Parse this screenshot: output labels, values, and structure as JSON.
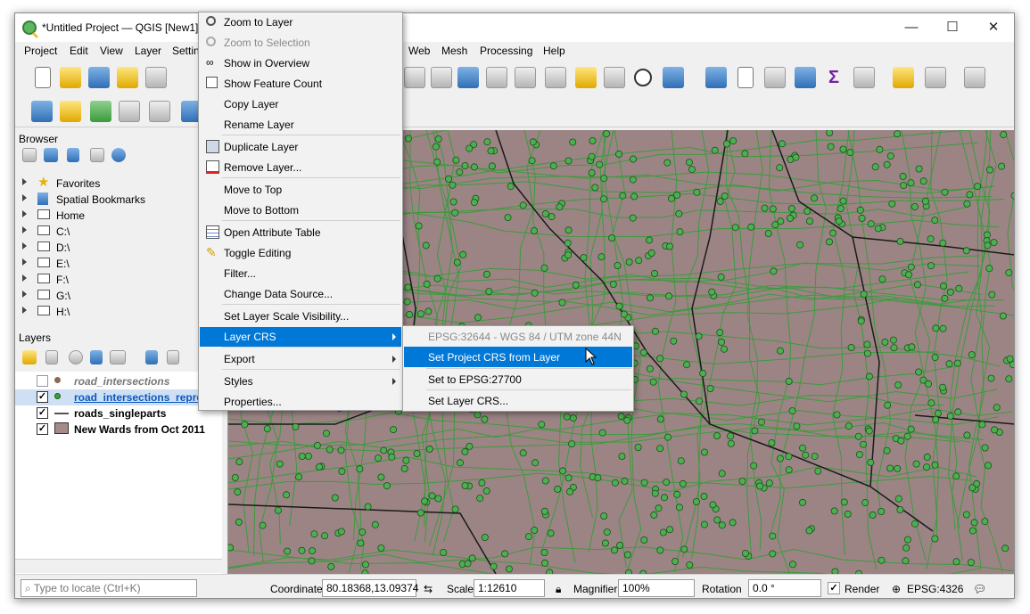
{
  "window": {
    "title": "*Untitled Project — QGIS [New1]",
    "controls": {
      "minimize": "—",
      "maximize": "☐",
      "close": "✕"
    }
  },
  "menubar": {
    "items": [
      "Project",
      "Edit",
      "View",
      "Layer",
      "Settin",
      "Web",
      "Mesh",
      "Processing",
      "Help"
    ]
  },
  "browser": {
    "title": "Browser",
    "items": [
      "Favorites",
      "Spatial Bookmarks",
      "Home",
      "C:\\",
      "D:\\",
      "E:\\",
      "F:\\",
      "G:\\",
      "H:\\"
    ]
  },
  "layers": {
    "title": "Layers",
    "items": [
      {
        "name": "road_intersections",
        "checked": false,
        "style": "italic-grey"
      },
      {
        "name": "road_intersections_repro",
        "checked": true,
        "style": "selected"
      },
      {
        "name": "roads_singleparts",
        "checked": true,
        "style": "bold"
      },
      {
        "name": "New Wards from Oct 2011",
        "checked": true,
        "style": "bold"
      }
    ],
    "check_mark": "✓"
  },
  "context_menu": {
    "items": [
      {
        "label": "Zoom to Layer",
        "icon": "zoom-icon",
        "disabled": false
      },
      {
        "label": "Zoom to Selection",
        "icon": "zoom-selection-icon",
        "disabled": true
      },
      {
        "label": "Show in Overview",
        "icon": "overview-icon",
        "disabled": false
      },
      {
        "label": "Show Feature Count",
        "icon": "checkbox-icon",
        "disabled": false
      },
      {
        "label": "Copy Layer",
        "icon": "",
        "disabled": false
      },
      {
        "label": "Rename Layer",
        "icon": "",
        "disabled": false
      },
      {
        "label": "Duplicate Layer",
        "icon": "duplicate-icon",
        "disabled": false
      },
      {
        "label": "Remove Layer...",
        "icon": "remove-layer-icon",
        "disabled": false
      },
      {
        "label": "Move to Top",
        "icon": "",
        "disabled": false
      },
      {
        "label": "Move to Bottom",
        "icon": "",
        "disabled": false
      },
      {
        "label": "Open Attribute Table",
        "icon": "table-icon",
        "disabled": false
      },
      {
        "label": "Toggle Editing",
        "icon": "pencil-icon",
        "disabled": false
      },
      {
        "label": "Filter...",
        "icon": "",
        "disabled": false
      },
      {
        "label": "Change Data Source...",
        "icon": "",
        "disabled": false
      },
      {
        "label": "Set Layer Scale Visibility...",
        "icon": "",
        "disabled": false
      },
      {
        "label": "Layer CRS",
        "icon": "",
        "disabled": false,
        "submenu": true
      },
      {
        "label": "Export",
        "icon": "",
        "disabled": false,
        "submenu": true
      },
      {
        "label": "Styles",
        "icon": "",
        "disabled": false,
        "submenu": true
      },
      {
        "label": "Properties...",
        "icon": "",
        "disabled": false
      }
    ]
  },
  "crs_submenu": {
    "items": [
      {
        "label": "EPSG:32644 - WGS 84 / UTM zone 44N",
        "disabled": true
      },
      {
        "label": "Set Project CRS from Layer",
        "disabled": false
      },
      {
        "label": "Set to EPSG:27700",
        "disabled": false
      },
      {
        "label": "Set Layer CRS...",
        "disabled": false
      }
    ]
  },
  "statusbar": {
    "locator_placeholder": "Type to locate (Ctrl+K)",
    "coordinate_label": "Coordinate",
    "coordinate_value": "80.18368,13.09374",
    "scale_label": "Scale",
    "scale_value": "1:12610",
    "magnifier_label": "Magnifier",
    "magnifier_value": "100%",
    "rotation_label": "Rotation",
    "rotation_value": "0.0 °",
    "render_label": "Render",
    "crs_label": "EPSG:4326"
  },
  "colors": {
    "map_fill": "#9c8485",
    "point_fill": "#4caf50",
    "road_line": "#3c9b3c",
    "ward_boundary": "#1a1a1a",
    "highlight": "#0078d7"
  }
}
